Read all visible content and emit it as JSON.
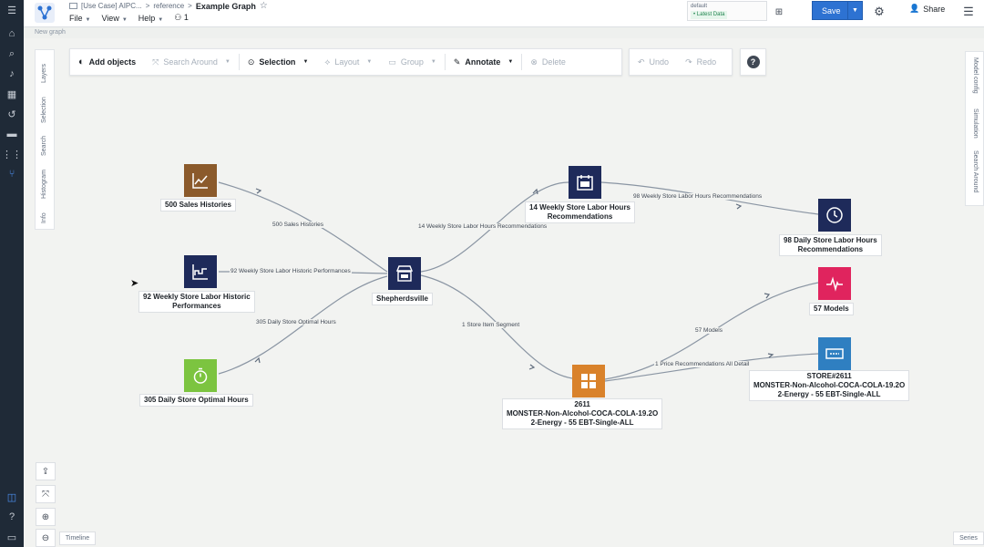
{
  "header": {
    "breadcrumb_project": "[Use Case] AIPC...",
    "breadcrumb_sep": ">",
    "breadcrumb_folder": "reference",
    "title": "Example Graph",
    "star_icon": "☆",
    "menus": [
      {
        "label": "File"
      },
      {
        "label": "View"
      },
      {
        "label": "Help"
      }
    ],
    "count_badge": "1",
    "branch_label": "default",
    "branch_tag": "• Latest Data",
    "save_label": "Save",
    "share_label": "Share",
    "subtitle": "New graph"
  },
  "toolbar": {
    "add_objects": "Add objects",
    "search_around": "Search Around",
    "selection": "Selection",
    "layout": "Layout",
    "group": "Group",
    "annotate": "Annotate",
    "delete": "Delete",
    "undo": "Undo",
    "redo": "Redo",
    "help": "?"
  },
  "left_tabs": [
    "Layers",
    "Selection",
    "Search",
    "Histogram",
    "Info"
  ],
  "right_tabs": [
    "Model config",
    "Simulation",
    "Search Around"
  ],
  "bottom": {
    "timeline": "Timeline",
    "series": "Series"
  },
  "colors": {
    "accent": "#2d72d2",
    "node_brown": "#8b5a2b",
    "node_navy": "#1e2a5a",
    "node_green": "#7cc440",
    "node_orange": "#d9822b",
    "node_pink": "#e0245e",
    "node_blue": "#2f7fc1"
  },
  "nodes": {
    "sales": {
      "label": "500 Sales Histories",
      "icon": "line-chart-icon"
    },
    "labor_hist": {
      "label1": "92 Weekly Store Labor Historic",
      "label2": "Performances",
      "icon": "chart-icon"
    },
    "optimal": {
      "label": "305 Daily Store Optimal Hours",
      "icon": "stopwatch-icon"
    },
    "store": {
      "label": "Shepherdsville",
      "icon": "shop-icon"
    },
    "weekly_rec": {
      "label1": "14 Weekly Store Labor Hours",
      "label2": "Recommendations",
      "icon": "calendar-icon"
    },
    "daily_rec": {
      "label1": "98 Daily Store Labor Hours",
      "label2": "Recommendations",
      "icon": "clock-icon"
    },
    "models": {
      "label": "57 Models",
      "icon": "pulse-icon"
    },
    "segment": {
      "label1": "2611",
      "label2": "MONSTER-Non-Alcohol-COCA-COLA-19.2O",
      "label3": "2-Energy - 55 EBT-Single-ALL",
      "icon": "grid-icon"
    },
    "store_rec": {
      "label1": "STORE#2611",
      "label2": "MONSTER-Non-Alcohol-COCA-COLA-19.2O",
      "label3": "2-Energy - 55 EBT-Single-ALL",
      "icon": "card-icon"
    }
  },
  "edges": {
    "sales": "500 Sales Histories",
    "labor_hist": "92 Weekly Store Labor Historic Performances",
    "optimal": "305 Daily Store Optimal Hours",
    "weekly": "14 Weekly Store Labor Hours Recommendations",
    "daily": "98 Weekly Store Labor Hours Recommendations",
    "segment": "1 Store Item Segment",
    "models": "57 Models",
    "price": "1 Price Recommendations All Detail"
  }
}
